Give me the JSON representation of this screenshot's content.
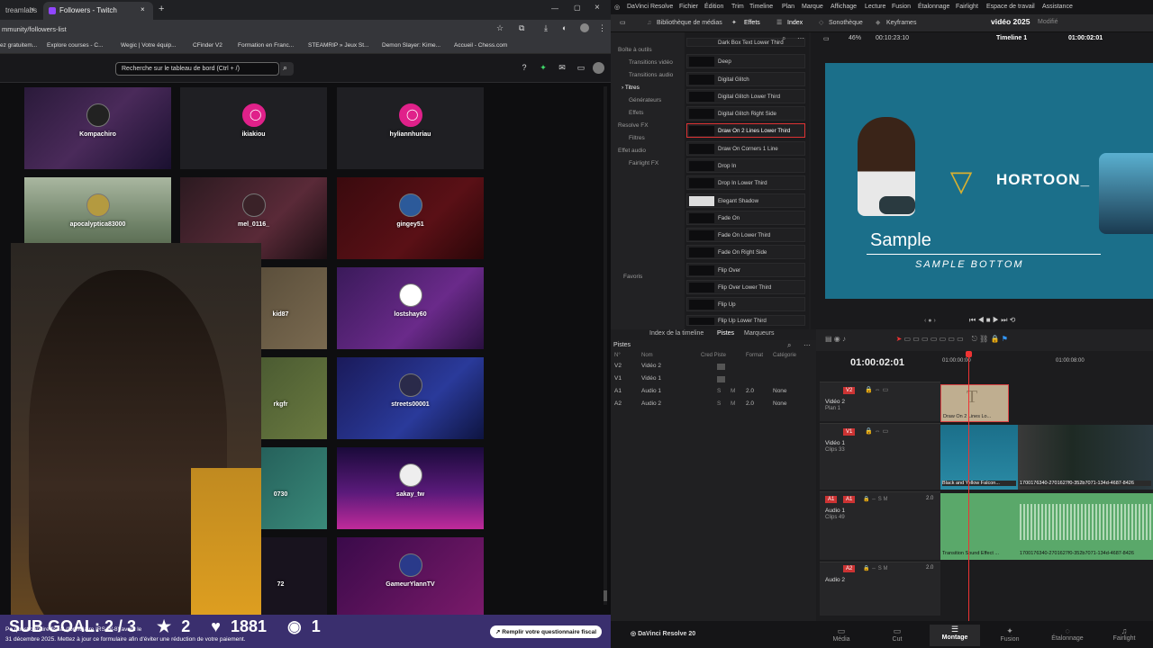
{
  "browser": {
    "tabs": [
      {
        "label": "treamlabs"
      },
      {
        "label": "Followers - Twitch"
      }
    ],
    "url": "mmunity/followers-list",
    "bookmarks": [
      "ez gratuitem...",
      "Explore courses - C...",
      "Wegic | Votre équip...",
      "CFinder V2",
      "Formation en Franc...",
      "STEAMRIP » Jeux St...",
      "Demon Slayer: Kime...",
      "Accueil - Chess.com"
    ]
  },
  "twitch": {
    "search_placeholder": "Recherche sur le tableau de bord (Ctrl + /)",
    "followers": [
      {
        "name": "Kompachiro"
      },
      {
        "name": "ikiakiou"
      },
      {
        "name": "hyliannhuriau"
      },
      {
        "name": "apocalyptica83000"
      },
      {
        "name": "mel_0116_"
      },
      {
        "name": "gingey51"
      },
      {
        "name": "kid87"
      },
      {
        "name": "lostshay60"
      },
      {
        "name": "rkgfr"
      },
      {
        "name": "streets00001"
      },
      {
        "name": "0730"
      },
      {
        "name": "sakay_tw"
      },
      {
        "name": "72"
      },
      {
        "name": "GameurYlannTV"
      }
    ],
    "notice": "31 décembre 2025. Mettez à jour ce formulaire afin d'éviter une réduction de votre paiement.",
    "notice_top": "Po                    questionnaire fiscal (formulaire IRS W-8) avant le",
    "fiscal_button": "Remplir votre questionnaire fiscal"
  },
  "stream_overlay": {
    "sub_goal": "SUB GOAL: 2 / 3",
    "stars": "2",
    "hearts": "1881",
    "viewers": "1"
  },
  "resolve": {
    "menu": [
      "DaVinci Resolve",
      "Fichier",
      "Édition",
      "Trim",
      "Timeline",
      "Plan",
      "Marque",
      "Affichage",
      "Lecture",
      "Fusion",
      "Étalonnage",
      "Fairlight",
      "Espace de travail",
      "Assistance"
    ],
    "toolbar": {
      "media_lib": "Bibliothèque de médias",
      "effects": "Effets",
      "index": "Index",
      "sound": "Sonothèque",
      "keyframes": "Keyframes",
      "project": "vidéo 2025",
      "modified": "Modifié"
    },
    "viewer": {
      "zoom": "46%",
      "timecode_left": "00:10:23:10",
      "timeline_name": "Timeline 1",
      "timecode_right": "01:00:02:01"
    },
    "tree": [
      "Boîte à outils",
      "Transitions vidéo",
      "Transitions audio",
      "Titres",
      "Générateurs",
      "Effets",
      "Resolve FX",
      "Filtres",
      "Effet audio",
      "Fairlight FX",
      "Favoris"
    ],
    "effects": [
      "Dark Box Text Lower Third",
      "Deep",
      "Digital Glitch",
      "Digital Glitch Lower Third",
      "Digital Glitch Right Side",
      "Draw On 2 Lines Lower Third",
      "Draw On Corners 1 Line",
      "Drop In",
      "Drop In Lower Third",
      "Elegant Shadow",
      "Fade On",
      "Fade On Lower Third",
      "Fade On Right Side",
      "Flip Over",
      "Flip Over Lower Third",
      "Flip Up",
      "Flip Up Lower Third"
    ],
    "preview": {
      "brand": "HORTOON_",
      "sample": "Sample",
      "sample_bottom": "SAMPLE BOTTOM"
    },
    "tabs": {
      "index": "Index de la timeline",
      "tracks": "Pistes",
      "markers": "Marqueurs"
    },
    "tracks_title": "Pistes",
    "tracks_cols": [
      "N°",
      "Nom",
      "Cred Piste",
      "Format",
      "Catégorie"
    ],
    "tracks_rows": [
      {
        "id": "V2",
        "name": "Vidéo 2",
        "fmt": "",
        "cat": ""
      },
      {
        "id": "V1",
        "name": "Vidéo 1",
        "fmt": "",
        "cat": ""
      },
      {
        "id": "A1",
        "name": "Audio 1",
        "fmt": "2.0",
        "cat": "None"
      },
      {
        "id": "A2",
        "name": "Audio 2",
        "fmt": "2.0",
        "cat": "None"
      }
    ],
    "timeline": {
      "timecode": "01:00:02:01",
      "ruler": [
        "01:00:00:00",
        "01:00:08:00"
      ],
      "v2": {
        "label": "V2",
        "name": "Vidéo 2",
        "sub": "Plan 1",
        "clip": "Draw On 2 Lines Lo..."
      },
      "v1": {
        "label": "V1",
        "name": "Vidéo 1",
        "sub": "Clips 33",
        "clip1": "Black and Yellow Falcon...",
        "clip2": "1700176340-2701627f0-352b7071-134d-4687-8426"
      },
      "a1": {
        "label": "A1",
        "name": "Audio 1",
        "sub": "Clips 49",
        "fmt": "2.0",
        "clip1": "Transition Sound Effect ...",
        "clip2": "1700176340-2701627f0-352b7071-134d-4687-8426"
      },
      "a2": {
        "label": "A2",
        "name": "Audio 2",
        "fmt": "2.0"
      }
    },
    "app_name": "DaVinci Resolve 20",
    "pages": [
      "Média",
      "Cut",
      "Montage",
      "Fusion",
      "Étalonnage",
      "Fairlight"
    ]
  }
}
